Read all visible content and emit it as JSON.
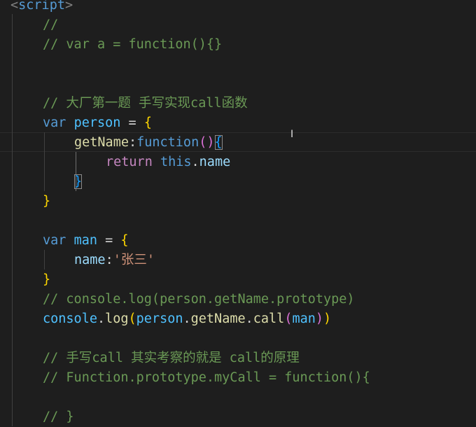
{
  "editor": {
    "language": "javascript",
    "lines": {
      "l1_open": "<",
      "l1_tag": "script",
      "l1_close": ">",
      "l2": "//",
      "l3": "// var a = function(){}",
      "l6": "// 大厂第一题 手写实现call函数",
      "l7_kw": "var",
      "l7_name": "person",
      "l7_eq": " = ",
      "l7_brace": "{",
      "l8_key": "getName",
      "l8_colon": ":",
      "l8_fn": "function",
      "l8_paren": "()",
      "l8_brace": "{",
      "l9_ret": "return",
      "l9_this": "this",
      "l9_dot": ".",
      "l9_prop": "name",
      "l10_brace": "}",
      "l11_brace": "}",
      "l13_kw": "var",
      "l13_name": "man",
      "l13_eq": " = ",
      "l13_brace": "{",
      "l14_key": "name",
      "l14_colon": ":",
      "l14_str": "'张三'",
      "l15_brace": "}",
      "l16": "// console.log(person.getName.prototype)",
      "l17_obj": "console",
      "l17_dot1": ".",
      "l17_fn": "log",
      "l17_p1": "(",
      "l17_a": "person",
      "l17_dot2": ".",
      "l17_b": "getName",
      "l17_dot3": ".",
      "l17_call": "call",
      "l17_p2": "(",
      "l17_arg": "man",
      "l17_p3": ")",
      "l17_p4": ")",
      "l19": "// 手写call 其实考察的就是 call的原理",
      "l20": "// Function.prototype.myCall = function(){",
      "l22": "// }"
    },
    "mouse_cursor": "I"
  },
  "colors": {
    "background": "#1e1e1e",
    "comment": "#6a9955",
    "keyword": "#569cd6",
    "variable": "#4fc1ff",
    "property": "#9cdcfe",
    "function": "#dcdcaa",
    "string": "#ce9178",
    "brace": "#ffd700",
    "paren": "#da70d6"
  }
}
